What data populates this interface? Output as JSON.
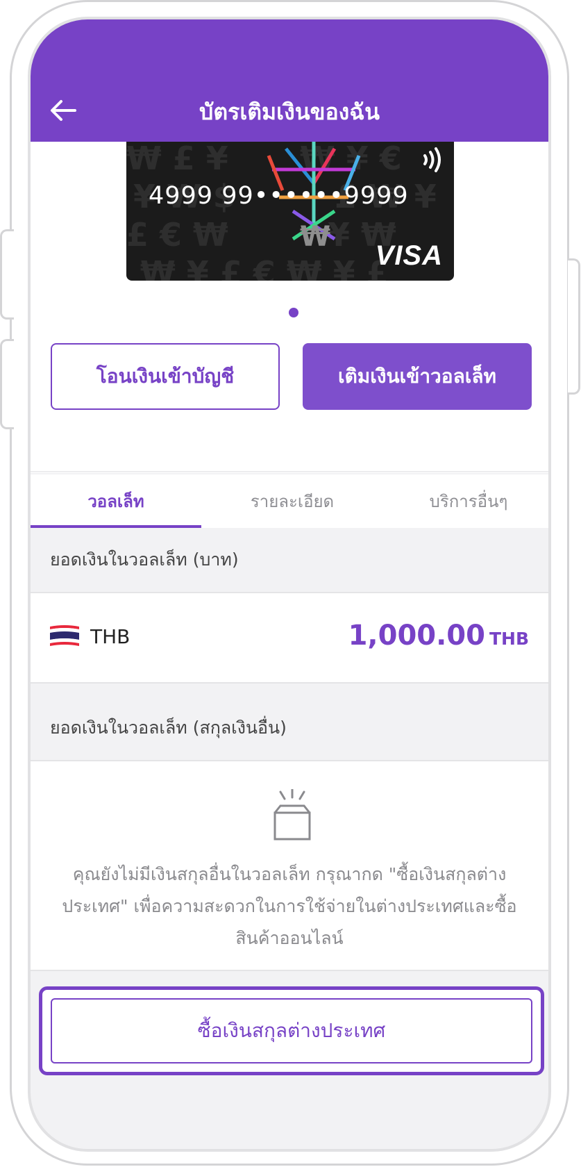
{
  "header": {
    "title": "บัตรเติมเงินของฉัน",
    "back_icon": "arrow-left-icon"
  },
  "card": {
    "number": "4999 99••••••9999",
    "brand": "VISA",
    "contactless_icon": "contactless-icon"
  },
  "actions": {
    "transfer_label": "โอนเงินเข้าบัญชี",
    "topup_label": "เติมเงินเข้าวอลเล็ท"
  },
  "tabs": [
    {
      "label": "วอลเล็ท",
      "active": true
    },
    {
      "label": "รายละเอียด",
      "active": false
    },
    {
      "label": "บริการอื่นๆ",
      "active": false
    }
  ],
  "wallet": {
    "thb_heading": "ยอดเงินในวอลเล็ท (บาท)",
    "thb_code": "THB",
    "thb_amount": "1,000.00",
    "thb_unit": "THB",
    "other_heading": "ยอดเงินในวอลเล็ท (สกุลเงินอื่น)",
    "empty_message": "คุณยังไม่มีเงินสกุลอื่นในวอลเล็ท กรุณากด \"ซื้อเงินสกุลต่างประเทศ\" เพื่อความสะดวกในการใช้จ่ายในต่างประเทศและซื้อสินค้าออนไลน์",
    "buy_label": "ซื้อเงินสกุลต่างประเทศ"
  },
  "colors": {
    "accent": "#7742c6",
    "background": "#f2f2f4"
  }
}
